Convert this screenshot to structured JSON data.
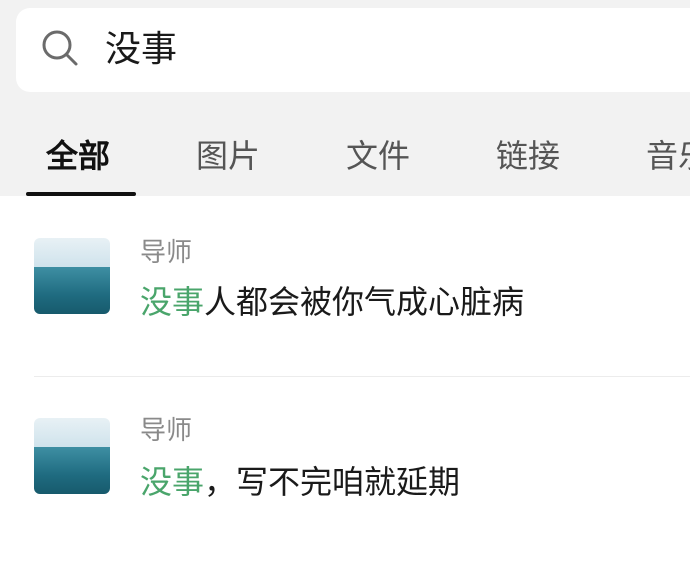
{
  "search": {
    "query": "没事"
  },
  "tabs": [
    {
      "label": "全部",
      "active": true
    },
    {
      "label": "图片",
      "active": false
    },
    {
      "label": "文件",
      "active": false
    },
    {
      "label": "链接",
      "active": false
    },
    {
      "label": "音乐",
      "active": false
    }
  ],
  "results": [
    {
      "sender": "导师",
      "highlight": "没事",
      "rest": "人都会被你气成心脏病"
    },
    {
      "sender": "导师",
      "highlight": "没事",
      "rest": "，写不完咱就延期"
    }
  ],
  "colors": {
    "highlight": "#4aa56b",
    "background": "#f2f2f2"
  }
}
